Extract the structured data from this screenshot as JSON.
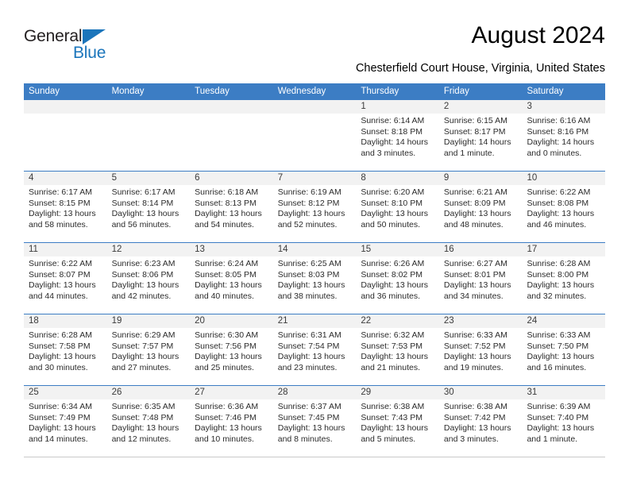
{
  "brand": {
    "name_dark": "General",
    "name_blue": "Blue",
    "logo_icon": "triangle-logo-icon",
    "color_dark": "#231f20",
    "color_blue": "#1b75bb"
  },
  "header": {
    "title": "August 2024",
    "subtitle": "Chesterfield Court House, Virginia, United States"
  },
  "colors": {
    "header_blue": "#3c7dc4",
    "cell_head_gray": "#f2f2f2"
  },
  "weekdays": [
    "Sunday",
    "Monday",
    "Tuesday",
    "Wednesday",
    "Thursday",
    "Friday",
    "Saturday"
  ],
  "labels": {
    "sunrise": "Sunrise:",
    "sunset": "Sunset:",
    "daylight": "Daylight:"
  },
  "weeks": [
    [
      {
        "day": "",
        "empty": true
      },
      {
        "day": "",
        "empty": true
      },
      {
        "day": "",
        "empty": true
      },
      {
        "day": "",
        "empty": true
      },
      {
        "day": "1",
        "sunrise": "Sunrise: 6:14 AM",
        "sunset": "Sunset: 8:18 PM",
        "daylight1": "Daylight: 14 hours",
        "daylight2": "and 3 minutes."
      },
      {
        "day": "2",
        "sunrise": "Sunrise: 6:15 AM",
        "sunset": "Sunset: 8:17 PM",
        "daylight1": "Daylight: 14 hours",
        "daylight2": "and 1 minute."
      },
      {
        "day": "3",
        "sunrise": "Sunrise: 6:16 AM",
        "sunset": "Sunset: 8:16 PM",
        "daylight1": "Daylight: 14 hours",
        "daylight2": "and 0 minutes."
      }
    ],
    [
      {
        "day": "4",
        "sunrise": "Sunrise: 6:17 AM",
        "sunset": "Sunset: 8:15 PM",
        "daylight1": "Daylight: 13 hours",
        "daylight2": "and 58 minutes."
      },
      {
        "day": "5",
        "sunrise": "Sunrise: 6:17 AM",
        "sunset": "Sunset: 8:14 PM",
        "daylight1": "Daylight: 13 hours",
        "daylight2": "and 56 minutes."
      },
      {
        "day": "6",
        "sunrise": "Sunrise: 6:18 AM",
        "sunset": "Sunset: 8:13 PM",
        "daylight1": "Daylight: 13 hours",
        "daylight2": "and 54 minutes."
      },
      {
        "day": "7",
        "sunrise": "Sunrise: 6:19 AM",
        "sunset": "Sunset: 8:12 PM",
        "daylight1": "Daylight: 13 hours",
        "daylight2": "and 52 minutes."
      },
      {
        "day": "8",
        "sunrise": "Sunrise: 6:20 AM",
        "sunset": "Sunset: 8:10 PM",
        "daylight1": "Daylight: 13 hours",
        "daylight2": "and 50 minutes."
      },
      {
        "day": "9",
        "sunrise": "Sunrise: 6:21 AM",
        "sunset": "Sunset: 8:09 PM",
        "daylight1": "Daylight: 13 hours",
        "daylight2": "and 48 minutes."
      },
      {
        "day": "10",
        "sunrise": "Sunrise: 6:22 AM",
        "sunset": "Sunset: 8:08 PM",
        "daylight1": "Daylight: 13 hours",
        "daylight2": "and 46 minutes."
      }
    ],
    [
      {
        "day": "11",
        "sunrise": "Sunrise: 6:22 AM",
        "sunset": "Sunset: 8:07 PM",
        "daylight1": "Daylight: 13 hours",
        "daylight2": "and 44 minutes."
      },
      {
        "day": "12",
        "sunrise": "Sunrise: 6:23 AM",
        "sunset": "Sunset: 8:06 PM",
        "daylight1": "Daylight: 13 hours",
        "daylight2": "and 42 minutes."
      },
      {
        "day": "13",
        "sunrise": "Sunrise: 6:24 AM",
        "sunset": "Sunset: 8:05 PM",
        "daylight1": "Daylight: 13 hours",
        "daylight2": "and 40 minutes."
      },
      {
        "day": "14",
        "sunrise": "Sunrise: 6:25 AM",
        "sunset": "Sunset: 8:03 PM",
        "daylight1": "Daylight: 13 hours",
        "daylight2": "and 38 minutes."
      },
      {
        "day": "15",
        "sunrise": "Sunrise: 6:26 AM",
        "sunset": "Sunset: 8:02 PM",
        "daylight1": "Daylight: 13 hours",
        "daylight2": "and 36 minutes."
      },
      {
        "day": "16",
        "sunrise": "Sunrise: 6:27 AM",
        "sunset": "Sunset: 8:01 PM",
        "daylight1": "Daylight: 13 hours",
        "daylight2": "and 34 minutes."
      },
      {
        "day": "17",
        "sunrise": "Sunrise: 6:28 AM",
        "sunset": "Sunset: 8:00 PM",
        "daylight1": "Daylight: 13 hours",
        "daylight2": "and 32 minutes."
      }
    ],
    [
      {
        "day": "18",
        "sunrise": "Sunrise: 6:28 AM",
        "sunset": "Sunset: 7:58 PM",
        "daylight1": "Daylight: 13 hours",
        "daylight2": "and 30 minutes."
      },
      {
        "day": "19",
        "sunrise": "Sunrise: 6:29 AM",
        "sunset": "Sunset: 7:57 PM",
        "daylight1": "Daylight: 13 hours",
        "daylight2": "and 27 minutes."
      },
      {
        "day": "20",
        "sunrise": "Sunrise: 6:30 AM",
        "sunset": "Sunset: 7:56 PM",
        "daylight1": "Daylight: 13 hours",
        "daylight2": "and 25 minutes."
      },
      {
        "day": "21",
        "sunrise": "Sunrise: 6:31 AM",
        "sunset": "Sunset: 7:54 PM",
        "daylight1": "Daylight: 13 hours",
        "daylight2": "and 23 minutes."
      },
      {
        "day": "22",
        "sunrise": "Sunrise: 6:32 AM",
        "sunset": "Sunset: 7:53 PM",
        "daylight1": "Daylight: 13 hours",
        "daylight2": "and 21 minutes."
      },
      {
        "day": "23",
        "sunrise": "Sunrise: 6:33 AM",
        "sunset": "Sunset: 7:52 PM",
        "daylight1": "Daylight: 13 hours",
        "daylight2": "and 19 minutes."
      },
      {
        "day": "24",
        "sunrise": "Sunrise: 6:33 AM",
        "sunset": "Sunset: 7:50 PM",
        "daylight1": "Daylight: 13 hours",
        "daylight2": "and 16 minutes."
      }
    ],
    [
      {
        "day": "25",
        "sunrise": "Sunrise: 6:34 AM",
        "sunset": "Sunset: 7:49 PM",
        "daylight1": "Daylight: 13 hours",
        "daylight2": "and 14 minutes."
      },
      {
        "day": "26",
        "sunrise": "Sunrise: 6:35 AM",
        "sunset": "Sunset: 7:48 PM",
        "daylight1": "Daylight: 13 hours",
        "daylight2": "and 12 minutes."
      },
      {
        "day": "27",
        "sunrise": "Sunrise: 6:36 AM",
        "sunset": "Sunset: 7:46 PM",
        "daylight1": "Daylight: 13 hours",
        "daylight2": "and 10 minutes."
      },
      {
        "day": "28",
        "sunrise": "Sunrise: 6:37 AM",
        "sunset": "Sunset: 7:45 PM",
        "daylight1": "Daylight: 13 hours",
        "daylight2": "and 8 minutes."
      },
      {
        "day": "29",
        "sunrise": "Sunrise: 6:38 AM",
        "sunset": "Sunset: 7:43 PM",
        "daylight1": "Daylight: 13 hours",
        "daylight2": "and 5 minutes."
      },
      {
        "day": "30",
        "sunrise": "Sunrise: 6:38 AM",
        "sunset": "Sunset: 7:42 PM",
        "daylight1": "Daylight: 13 hours",
        "daylight2": "and 3 minutes."
      },
      {
        "day": "31",
        "sunrise": "Sunrise: 6:39 AM",
        "sunset": "Sunset: 7:40 PM",
        "daylight1": "Daylight: 13 hours",
        "daylight2": "and 1 minute."
      }
    ]
  ]
}
